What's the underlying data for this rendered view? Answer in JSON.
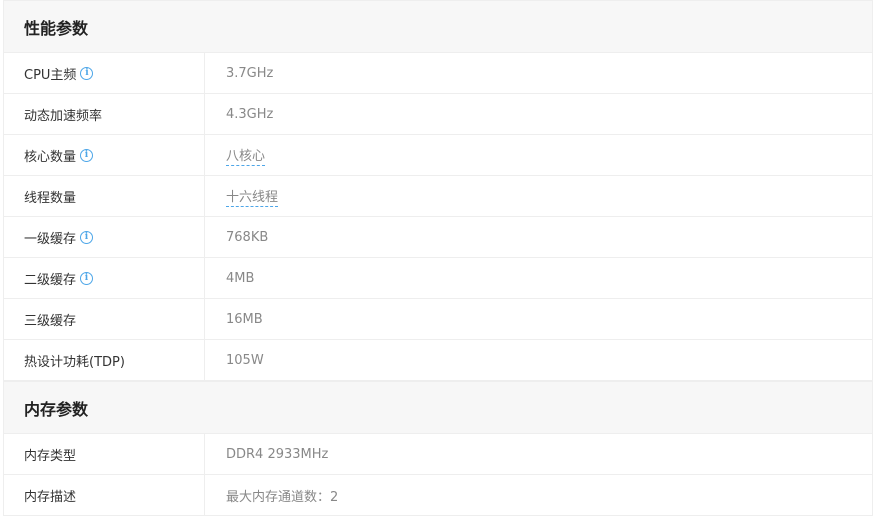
{
  "sections": [
    {
      "title": "性能参数",
      "rows": [
        {
          "name": "CPU主频",
          "value": "3.7GHz",
          "info": true,
          "link": false
        },
        {
          "name": "动态加速频率",
          "value": "4.3GHz",
          "info": false,
          "link": false
        },
        {
          "name": "核心数量",
          "value": "八核心",
          "info": true,
          "link": true
        },
        {
          "name": "线程数量",
          "value": "十六线程",
          "info": false,
          "link": true
        },
        {
          "name": "一级缓存",
          "value": "768KB",
          "info": true,
          "link": false
        },
        {
          "name": "二级缓存",
          "value": "4MB",
          "info": true,
          "link": false
        },
        {
          "name": "三级缓存",
          "value": "16MB",
          "info": false,
          "link": false
        },
        {
          "name": "热设计功耗(TDP)",
          "value": "105W",
          "info": false,
          "link": false
        }
      ]
    },
    {
      "title": "内存参数",
      "rows": [
        {
          "name": "内存类型",
          "value": "DDR4 2933MHz",
          "info": false,
          "link": false
        },
        {
          "name": "内存描述",
          "value": "最大内存通道数：2",
          "info": false,
          "link": false
        }
      ]
    }
  ],
  "info_icon_glyph": "i",
  "colors": {
    "accent": "#4da6e8",
    "header_bg": "#f7f7f7",
    "border": "#eeeeee",
    "value_text": "#888888"
  }
}
